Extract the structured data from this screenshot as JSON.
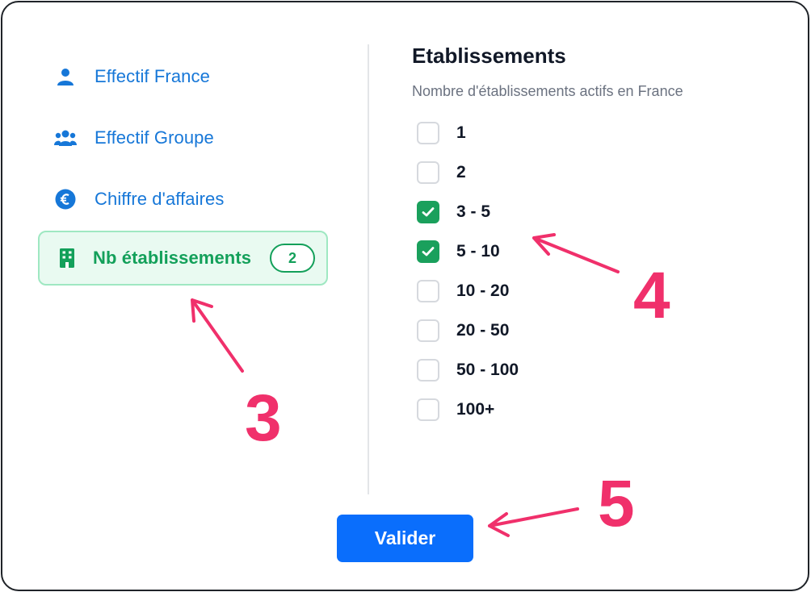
{
  "sidebar": {
    "items": [
      {
        "label": "Effectif France",
        "icon": "person-icon",
        "active": false
      },
      {
        "label": "Effectif Groupe",
        "icon": "group-icon",
        "active": false
      },
      {
        "label": "Chiffre d'affaires",
        "icon": "euro-icon",
        "active": false
      },
      {
        "label": "Nb établissements",
        "icon": "building-icon",
        "active": true,
        "badge": "2"
      }
    ]
  },
  "panel": {
    "title": "Etablissements",
    "subtitle": "Nombre d'établissements actifs en France",
    "options": [
      {
        "label": "1",
        "checked": false
      },
      {
        "label": "2",
        "checked": false
      },
      {
        "label": "3 - 5",
        "checked": true
      },
      {
        "label": "5 - 10",
        "checked": true
      },
      {
        "label": "10 - 20",
        "checked": false
      },
      {
        "label": "20 - 50",
        "checked": false
      },
      {
        "label": "50 - 100",
        "checked": false
      },
      {
        "label": "100+",
        "checked": false
      }
    ]
  },
  "actions": {
    "submit_label": "Valider"
  },
  "annotations": {
    "step3": "3",
    "step4": "4",
    "step5": "5"
  },
  "colors": {
    "link": "#1677d8",
    "active_green": "#13a05a",
    "active_bg": "#e9faf1",
    "primary_button": "#0a6efc",
    "annotation": "#f0306b"
  }
}
